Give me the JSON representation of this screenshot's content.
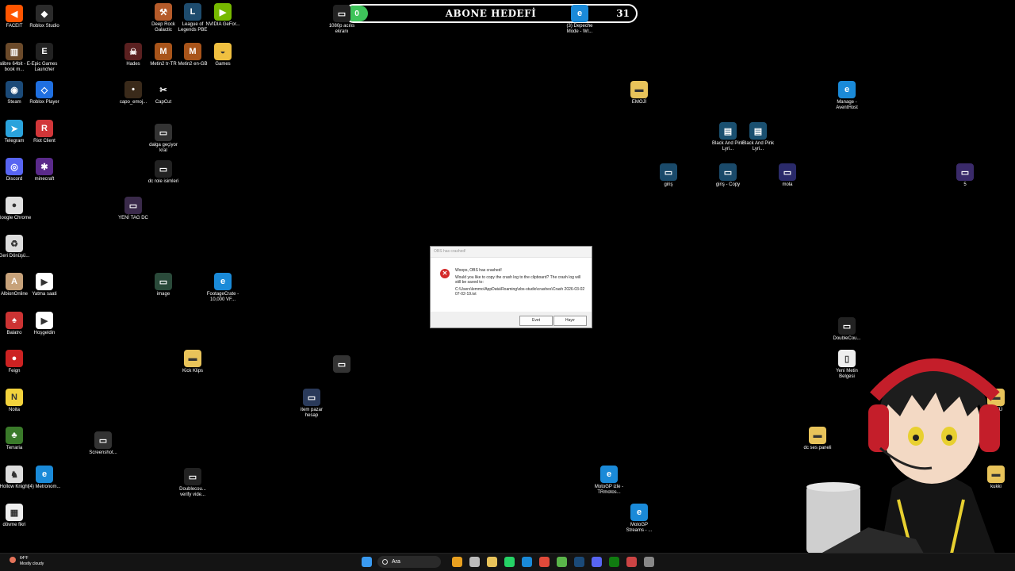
{
  "goal": {
    "count": "0",
    "title": "ABONE HEDEFİ",
    "target": "31"
  },
  "desktop_icons": [
    {
      "label": "FACEIT",
      "color": "#ff5500",
      "glyph": "◀",
      "key": "faceit"
    },
    {
      "label": "Roblox Studio",
      "color": "#2b2b2b",
      "glyph": "◆",
      "key": "roblox-studio"
    },
    {
      "label": "Deep Rock Galactic",
      "color": "#b55b2a",
      "glyph": "⚒",
      "key": "deep-rock"
    },
    {
      "label": "League of Legends PBE",
      "color": "#1e4c6e",
      "glyph": "L",
      "key": "lol-pbe"
    },
    {
      "label": "NVIDIA GeFor...",
      "color": "#76b900",
      "glyph": "▶",
      "key": "nvidia"
    },
    {
      "label": "calibre 64bit - E-book m...",
      "color": "#6b4a2a",
      "glyph": "▥",
      "key": "calibre"
    },
    {
      "label": "Epic Games Launcher",
      "color": "#222",
      "glyph": "E",
      "key": "epic"
    },
    {
      "label": "Hades",
      "color": "#5a2020",
      "glyph": "☠",
      "key": "hades"
    },
    {
      "label": "Metin2 tr-TR",
      "color": "#a8541a",
      "glyph": "M",
      "key": "metin2-tr"
    },
    {
      "label": "Metin2 en-GB",
      "color": "#a8541a",
      "glyph": "M",
      "key": "metin2-en"
    },
    {
      "label": "Games",
      "color": "#f0c040",
      "glyph": "◒",
      "key": "games"
    },
    {
      "label": "Steam",
      "color": "#1b4a78",
      "glyph": "◉",
      "key": "steam"
    },
    {
      "label": "Roblox Player",
      "color": "#1f6fe0",
      "glyph": "◇",
      "key": "roblox-player"
    },
    {
      "label": "capo_emoj...",
      "color": "#3a2a1a",
      "glyph": "•",
      "key": "capo"
    },
    {
      "label": "CapCut",
      "color": "#000",
      "glyph": "✂",
      "key": "capcut"
    },
    {
      "label": "EMOJİ",
      "color": "#e8c35a",
      "glyph": "▬",
      "key": "emoji"
    },
    {
      "label": "Manage - AventHost",
      "color": "#1a8ad8",
      "glyph": "e",
      "key": "aventhost"
    },
    {
      "label": "Telegram",
      "color": "#2aa3dc",
      "glyph": "➤",
      "key": "telegram"
    },
    {
      "label": "Riot Client",
      "color": "#d13639",
      "glyph": "R",
      "key": "riot"
    },
    {
      "label": "dalga geçiyor kral",
      "color": "#333",
      "glyph": "▭",
      "key": "dalga"
    },
    {
      "label": "Black And Pink Lyri...",
      "color": "#1a5070",
      "glyph": "▤",
      "key": "bp1"
    },
    {
      "label": "Black And Pink Lyri...",
      "color": "#1a5070",
      "glyph": "▤",
      "key": "bp2"
    },
    {
      "label": "Discord",
      "color": "#5865f2",
      "glyph": "◎",
      "key": "discord"
    },
    {
      "label": "minecraft",
      "color": "#5a2a8a",
      "glyph": "✱",
      "key": "minecraft"
    },
    {
      "label": "dc role isimleri",
      "color": "#222",
      "glyph": "▭",
      "key": "dc-role"
    },
    {
      "label": "giriş",
      "color": "#1a4a6a",
      "glyph": "▭",
      "key": "giris"
    },
    {
      "label": "giriş - Copy",
      "color": "#1a4a6a",
      "glyph": "▭",
      "key": "giris-copy"
    },
    {
      "label": "mola",
      "color": "#2a2a6a",
      "glyph": "▭",
      "key": "mola"
    },
    {
      "label": "5",
      "color": "#3a2a6a",
      "glyph": "▭",
      "key": "five"
    },
    {
      "label": "Google Chrome",
      "color": "#e0e0e0",
      "glyph": "●",
      "key": "chrome"
    },
    {
      "label": "YENİ TAG DC",
      "color": "#3a2a4a",
      "glyph": "▭",
      "key": "yeni-tag"
    },
    {
      "label": "Geri Dönüşü...",
      "color": "#ddd",
      "glyph": "♻",
      "key": "recycle"
    },
    {
      "label": "AlbionOnline",
      "color": "#c7a27a",
      "glyph": "A",
      "key": "albion"
    },
    {
      "label": "Yatma saati",
      "color": "#fff",
      "glyph": "▶",
      "key": "yatma"
    },
    {
      "label": "image",
      "color": "#2a4a3a",
      "glyph": "▭",
      "key": "image"
    },
    {
      "label": "FootageCrate - 10,000 VF...",
      "color": "#1a8ad8",
      "glyph": "e",
      "key": "footage"
    },
    {
      "label": "Balatro",
      "color": "#c33",
      "glyph": "♠",
      "key": "balatro"
    },
    {
      "label": "Hoşgeldin",
      "color": "#fff",
      "glyph": "▶",
      "key": "hosgeldin"
    },
    {
      "label": "DoubleCou...",
      "color": "#222",
      "glyph": "▭",
      "key": "doublecou1"
    },
    {
      "label": "Feign",
      "color": "#c22",
      "glyph": "●",
      "key": "feign"
    },
    {
      "label": "Kick Klips",
      "color": "#e8c35a",
      "glyph": "▬",
      "key": "kick"
    },
    {
      "label": "Yeni Metin Belgesi",
      "color": "#eee",
      "glyph": "▯",
      "key": "metin-belgesi"
    },
    {
      "label": "Noita",
      "color": "#f2d23c",
      "glyph": "N",
      "key": "noita"
    },
    {
      "label": "item pazar hesap",
      "color": "#2a3a5a",
      "glyph": "▭",
      "key": "item-pazar"
    },
    {
      "label": "Terraria",
      "color": "#3a7a2a",
      "glyph": "♣",
      "key": "terraria"
    },
    {
      "label": "Screenshot...",
      "color": "#333",
      "glyph": "▭",
      "key": "screenshot"
    },
    {
      "label": "dc ses paneli",
      "color": "#e8c35a",
      "glyph": "▬",
      "key": "dc-ses"
    },
    {
      "label": "Hollow Knight",
      "color": "#ddd",
      "glyph": "♞",
      "key": "hollow"
    },
    {
      "label": "(4) Metronom...",
      "color": "#1a8ad8",
      "glyph": "e",
      "key": "metronom"
    },
    {
      "label": "Doublecou... verify vide...",
      "color": "#222",
      "glyph": "▭",
      "key": "doublecou2"
    },
    {
      "label": "MotoGP izle - TRmotos...",
      "color": "#1a8ad8",
      "glyph": "e",
      "key": "motogp1"
    },
    {
      "label": "(3) Depeche Mode - Wr...",
      "color": "#1a8ad8",
      "glyph": "e",
      "key": "depeche"
    },
    {
      "label": "1080p acılıs ekranı",
      "color": "#222",
      "glyph": "▭",
      "key": "acilis"
    },
    {
      "label": "dövme fikri",
      "color": "#eee",
      "glyph": "▦",
      "key": "dovme"
    },
    {
      "label": "MotoGP Streams - ...",
      "color": "#1a8ad8",
      "glyph": "e",
      "key": "motogp2"
    },
    {
      "label": "ÜSTÜ",
      "color": "#e8c35a",
      "glyph": "▬",
      "key": "ustu"
    },
    {
      "label": "kukki",
      "color": "#e8c35a",
      "glyph": "▬",
      "key": "kukki"
    },
    {
      "label": "",
      "color": "#333",
      "glyph": "▭",
      "key": "unnamed"
    }
  ],
  "dialog": {
    "title": "OBS has crashed!",
    "heading": "Woops, OBS has crashed!",
    "body": "Would you like to copy the crash log to the clipboard? The crash log will still be saved to:",
    "path": "C:\\Users\\lemmo\\AppData\\Roaming\\obs-studio\\crashes\\Crash 2026-03-02 07-02-19.txt",
    "yes_label": "Evet",
    "no_label": "Hayır"
  },
  "taskbar": {
    "weather_temp": "64°F",
    "weather_text": "Mostly cloudy",
    "search_placeholder": "Ara",
    "apps": [
      {
        "key": "start",
        "color": "#3a9af0"
      },
      {
        "key": "widgets",
        "color": "#e8a020"
      },
      {
        "key": "task-view",
        "color": "#bbb"
      },
      {
        "key": "file-explorer",
        "color": "#e8c35a"
      },
      {
        "key": "whatsapp",
        "color": "#25d366"
      },
      {
        "key": "edge",
        "color": "#1a8ad8"
      },
      {
        "key": "chrome",
        "color": "#e04a3a"
      },
      {
        "key": "xbox-app",
        "color": "#5ab54a"
      },
      {
        "key": "steam",
        "color": "#1b4a78"
      },
      {
        "key": "discord",
        "color": "#5865f2"
      },
      {
        "key": "xbox",
        "color": "#107c10"
      },
      {
        "key": "antivirus",
        "color": "#c44"
      },
      {
        "key": "settings",
        "color": "#888"
      }
    ]
  }
}
